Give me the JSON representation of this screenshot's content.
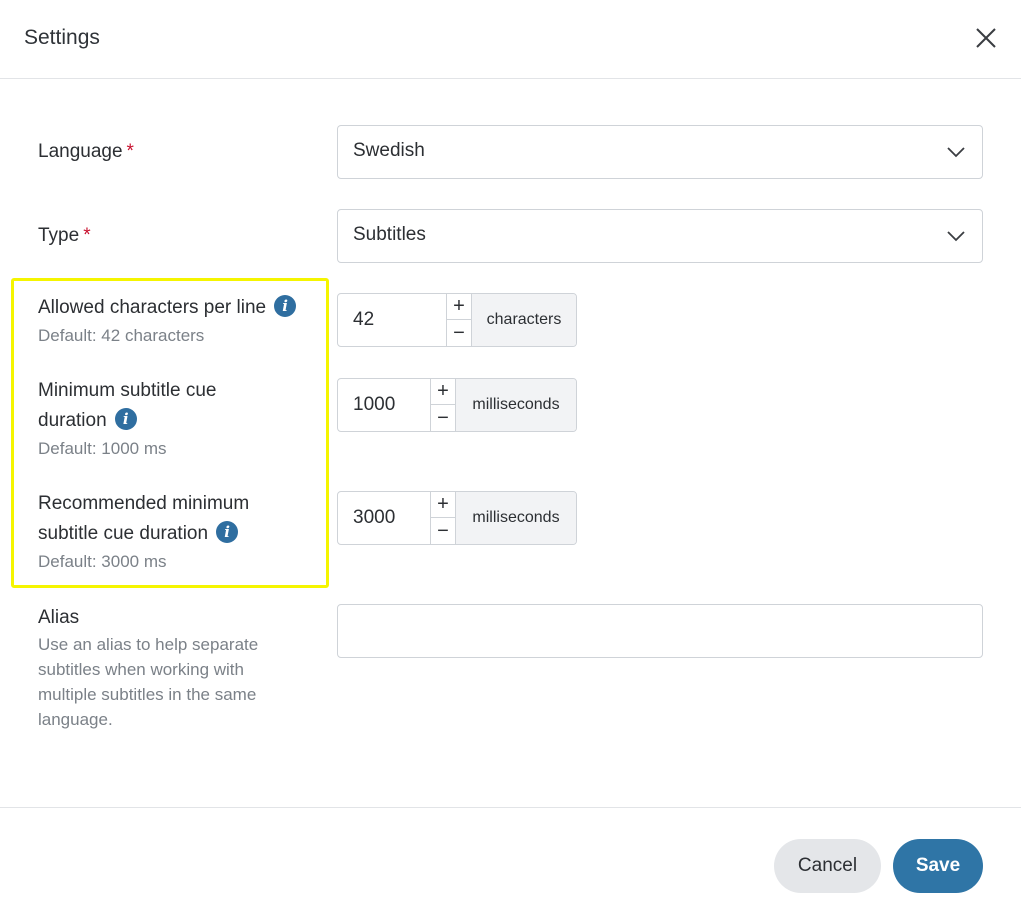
{
  "header": {
    "title": "Settings"
  },
  "language": {
    "label": "Language",
    "required_mark": "*",
    "value": "Swedish"
  },
  "type": {
    "label": "Type",
    "required_mark": "*",
    "value": "Subtitles"
  },
  "chars_per_line": {
    "label": "Allowed characters per line",
    "hint": "Default: 42 characters",
    "value": "42",
    "unit": "characters"
  },
  "min_cue": {
    "label_line1": "Minimum subtitle cue",
    "label_line2": "duration",
    "hint": "Default: 1000 ms",
    "value": "1000",
    "unit": "milliseconds"
  },
  "rec_min_cue": {
    "label_line1": "Recommended minimum",
    "label_line2": "subtitle cue duration",
    "hint": "Default: 3000 ms",
    "value": "3000",
    "unit": "milliseconds"
  },
  "alias": {
    "label": "Alias",
    "hint_lines": [
      "Use an alias to help separate",
      "subtitles when working with",
      "multiple subtitles in the same",
      "language."
    ],
    "value": ""
  },
  "icons": {
    "info": "i",
    "plus": "+",
    "minus": "−"
  },
  "footer": {
    "cancel_label": "Cancel",
    "save_label": "Save"
  },
  "colors": {
    "accent": "#2f75a6",
    "highlight": "#f5f500",
    "required": "#c8102e",
    "info": "#2f6ea0"
  }
}
